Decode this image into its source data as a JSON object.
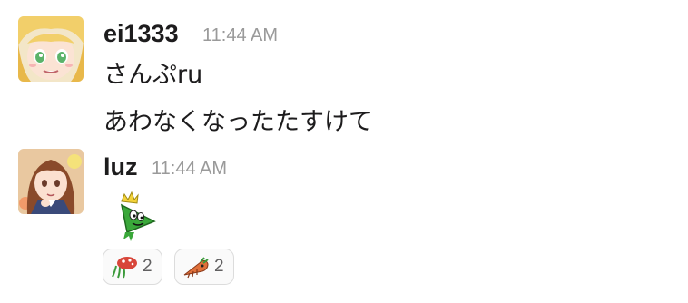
{
  "messages": [
    {
      "user": "ei1333",
      "time": "11:44 AM",
      "lines": [
        "さんぷru",
        "あわなくなったたすけて"
      ],
      "avatar_icon": "anime-girl-blonde-avatar"
    },
    {
      "user": "luz",
      "time": "11:44 AM",
      "emoji_icon": "green-crowned-triangle-emoji",
      "avatar_icon": "anime-girl-brown-hair-avatar",
      "reactions": [
        {
          "icon": "red-mushroom-creature-emoji",
          "count": "2"
        },
        {
          "icon": "crawling-carrot-creature-emoji",
          "count": "2"
        }
      ]
    }
  ],
  "colors": {
    "name": "#1d1c1d",
    "timestamp": "#9a9a9a",
    "reaction_border": "#dcdcdc"
  }
}
